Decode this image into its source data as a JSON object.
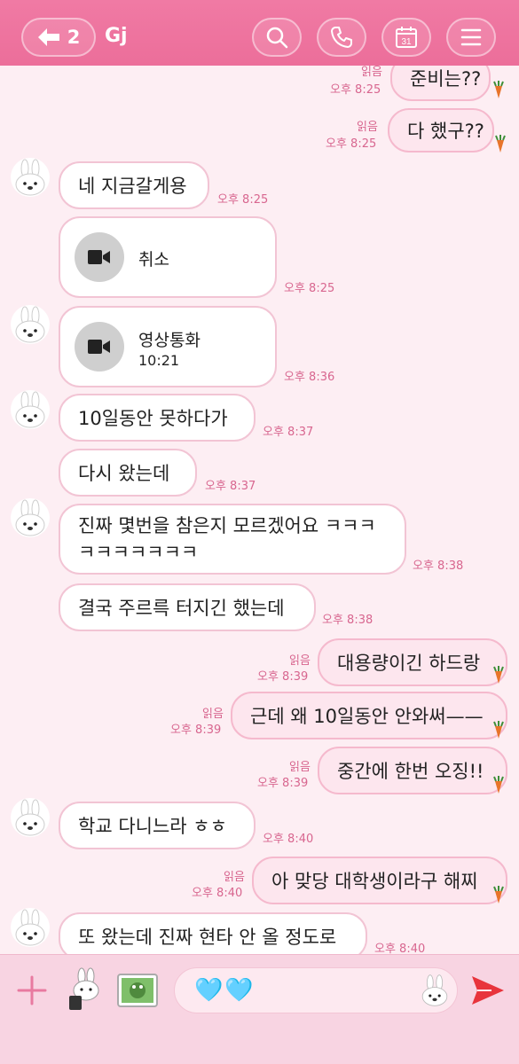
{
  "header": {
    "back_count": "2",
    "title": "Gj",
    "calendar_day": "31"
  },
  "messages": [
    {
      "id": "m1",
      "side": "me",
      "text": "준비는??",
      "read": "읽음",
      "time": "오후 8:25"
    },
    {
      "id": "m2",
      "side": "me",
      "text": "다 했구??",
      "read": "읽음",
      "time": "오후 8:25"
    },
    {
      "id": "m3",
      "side": "them",
      "text": "네 지금갈게용",
      "time": "오후 8:25"
    },
    {
      "id": "m4",
      "side": "them",
      "call_title": "취소",
      "time": "오후 8:25"
    },
    {
      "id": "m5",
      "side": "them",
      "call_title": "영상통화",
      "call_duration": "10:21",
      "time": "오후 8:36"
    },
    {
      "id": "m6",
      "side": "them",
      "text": "10일동안 못하다가",
      "time": "오후 8:37"
    },
    {
      "id": "m7",
      "side": "them",
      "text": "다시 왔는데",
      "time": "오후 8:37"
    },
    {
      "id": "m8",
      "side": "them",
      "line1": "진짜 몇번을 참은지 모르겠어요 ㅋㅋㅋ",
      "line2": "ㅋㅋㅋㅋㅋㅋㅋ",
      "time": "오후 8:38"
    },
    {
      "id": "m9",
      "side": "them",
      "text": "결국 주르륵 터지긴 했는데",
      "time": "오후 8:38"
    },
    {
      "id": "m10",
      "side": "me",
      "text": "대용량이긴 하드랑",
      "read": "읽음",
      "time": "오후 8:39"
    },
    {
      "id": "m11",
      "side": "me",
      "text": "근데 왜 10일동안 안와써——",
      "read": "읽음",
      "time": "오후 8:39"
    },
    {
      "id": "m12",
      "side": "me",
      "text": "중간에 한번 오징!!",
      "read": "읽음",
      "time": "오후 8:39"
    },
    {
      "id": "m13",
      "side": "them",
      "text": "학교 다니느라 ㅎㅎ",
      "time": "오후 8:40"
    },
    {
      "id": "m14",
      "side": "me",
      "text": "아 맞당 대학생이라구 해찌",
      "read": "읽음",
      "time": "오후 8:40"
    },
    {
      "id": "m15",
      "side": "them",
      "text": "또 왔는데 진짜 현타 안 올 정도로",
      "time": "오후 8:40"
    }
  ],
  "composer": {
    "draft": "🩵🩵"
  },
  "colors": {
    "header": "#ec6e9a",
    "accent": "#d8668f",
    "send": "#e8343c",
    "carrot": "#e8742a"
  }
}
